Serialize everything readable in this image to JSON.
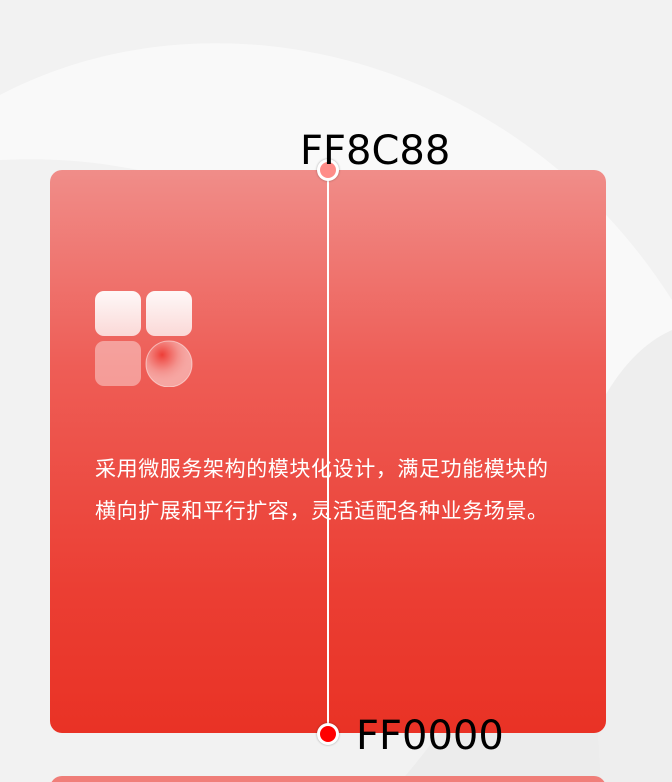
{
  "card": {
    "description": "采用微服务架构的模块化设计，满足功能模块的横向扩展和平行扩容，灵活适配各种业务场景。",
    "icon": "module-grid-icon",
    "gradient": {
      "top_color": "#FF8C88",
      "bottom_color": "#FF0000",
      "top_label": "FF8C88",
      "bottom_label": "FF0000"
    }
  },
  "colors": {
    "background": "#F2F2F2",
    "card_top": "#F08D89",
    "card_bottom": "#E93225",
    "text": "#FFFFFF"
  }
}
